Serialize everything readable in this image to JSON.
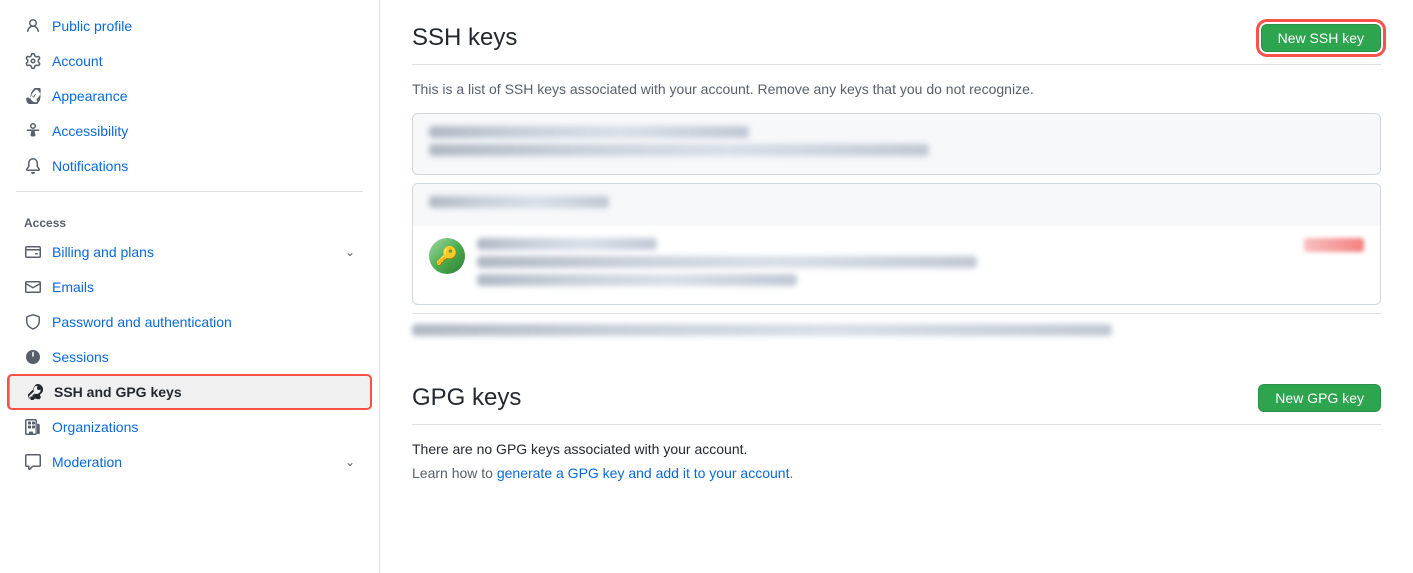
{
  "sidebar": {
    "items": [
      {
        "id": "public-profile",
        "label": "Public profile",
        "icon": "person",
        "active": false,
        "hasChevron": false
      },
      {
        "id": "account",
        "label": "Account",
        "icon": "gear",
        "active": false,
        "hasChevron": false
      },
      {
        "id": "appearance",
        "label": "Appearance",
        "icon": "paintbrush",
        "active": false,
        "hasChevron": false
      },
      {
        "id": "accessibility",
        "label": "Accessibility",
        "icon": "accessibility",
        "active": false,
        "hasChevron": false
      },
      {
        "id": "notifications",
        "label": "Notifications",
        "icon": "bell",
        "active": false,
        "hasChevron": false
      }
    ],
    "access_section": {
      "header": "Access",
      "items": [
        {
          "id": "billing",
          "label": "Billing and plans",
          "icon": "credit-card",
          "active": false,
          "hasChevron": true
        },
        {
          "id": "emails",
          "label": "Emails",
          "icon": "mail",
          "active": false,
          "hasChevron": false
        },
        {
          "id": "password-auth",
          "label": "Password and authentication",
          "icon": "shield",
          "active": false,
          "hasChevron": false
        },
        {
          "id": "sessions",
          "label": "Sessions",
          "icon": "radio",
          "active": false,
          "hasChevron": false
        },
        {
          "id": "ssh-gpg",
          "label": "SSH and GPG keys",
          "icon": "key",
          "active": true,
          "hasChevron": false
        },
        {
          "id": "organizations",
          "label": "Organizations",
          "icon": "org",
          "active": false,
          "hasChevron": false
        },
        {
          "id": "moderation",
          "label": "Moderation",
          "icon": "moderation",
          "active": false,
          "hasChevron": true
        }
      ]
    }
  },
  "main": {
    "ssh_section": {
      "title": "SSH keys",
      "new_button": "New SSH key",
      "description": "This is a list of SSH keys associated with your account. Remove any keys that you do not recognize."
    },
    "gpg_section": {
      "title": "GPG keys",
      "new_button": "New GPG key",
      "no_keys_text": "There are no GPG keys associated with your account.",
      "learn_prefix": "Learn how to ",
      "learn_link_text": "generate a GPG key and add it to your account",
      "learn_suffix": "."
    }
  }
}
